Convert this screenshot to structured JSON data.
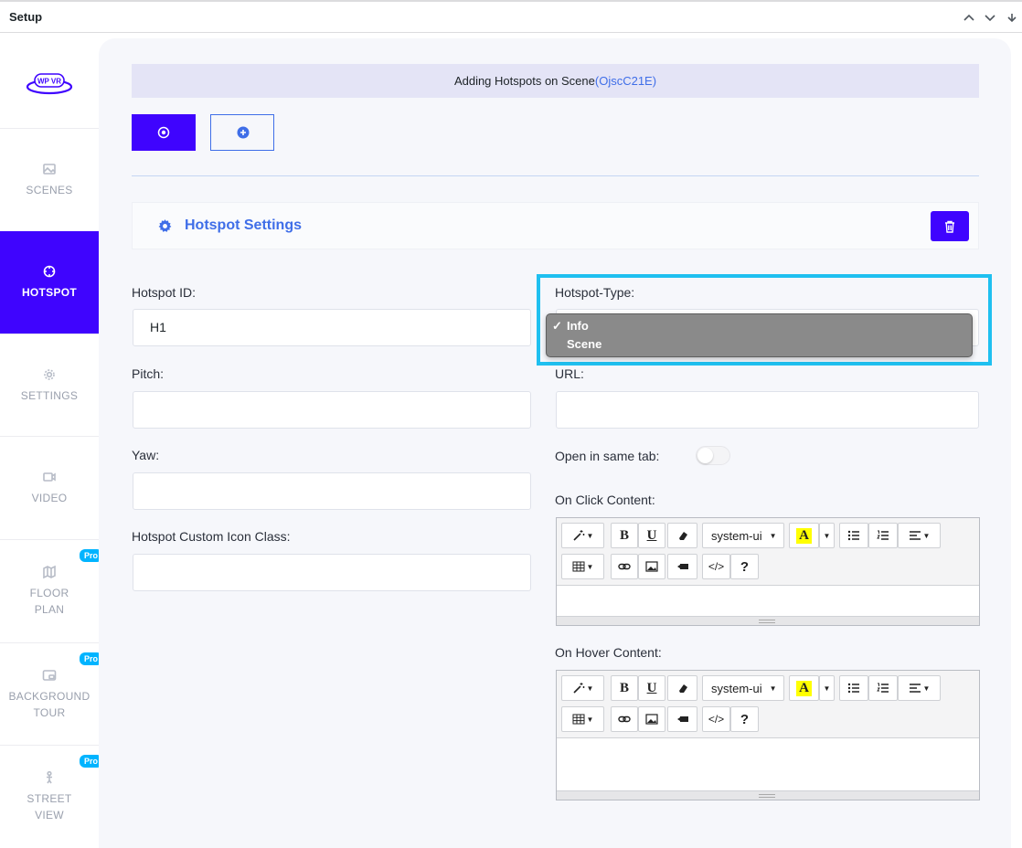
{
  "window": {
    "title": "Setup"
  },
  "sidebar": {
    "items": [
      {
        "label": "SCENES",
        "icon": "image-icon",
        "active": false
      },
      {
        "label": "HOTSPOT",
        "icon": "crosshair-icon",
        "active": true
      },
      {
        "label": "SETTINGS",
        "icon": "gear-icon",
        "active": false
      },
      {
        "label": "VIDEO",
        "icon": "video-icon",
        "active": false
      },
      {
        "label": "FLOOR PLAN",
        "icon": "map-icon",
        "active": false,
        "badge": "Pro"
      },
      {
        "label": "BACKGROUND TOUR",
        "icon": "picture-in-picture-icon",
        "active": false,
        "badge": "Pro"
      },
      {
        "label": "STREET VIEW",
        "icon": "pegman-icon",
        "active": false,
        "badge": "Pro"
      }
    ],
    "logo_text": "WP VR"
  },
  "banner": {
    "prefix": "Adding Hotspots on Scene",
    "scene_id": "(OjscC21E)"
  },
  "hotspot_settings": {
    "title": "Hotspot Settings"
  },
  "form": {
    "hotspot_id_label": "Hotspot ID:",
    "hotspot_id_value": "H1",
    "pitch_label": "Pitch:",
    "pitch_value": "",
    "yaw_label": "Yaw:",
    "yaw_value": "",
    "custom_icon_label": "Hotspot Custom Icon Class:",
    "custom_icon_value": "",
    "type_label": "Hotspot-Type:",
    "type_options": [
      "Info",
      "Scene"
    ],
    "type_selected": "Info",
    "url_label": "URL:",
    "url_value": "",
    "open_same_tab_label": "Open in same tab:",
    "open_same_tab_on": false,
    "on_click_label": "On Click Content:",
    "on_hover_label": "On Hover Content:"
  },
  "editor_toolbar": {
    "font_name": "system-ui",
    "bold": "B",
    "underline": "U",
    "code": "</>",
    "help": "?",
    "highlight_letter": "A",
    "highlight_color": "#ffff00"
  },
  "colors": {
    "accent": "#3f04fe",
    "link": "#3f6ee8",
    "badge": "#00b4ff",
    "callout": "#1fc0f0"
  }
}
